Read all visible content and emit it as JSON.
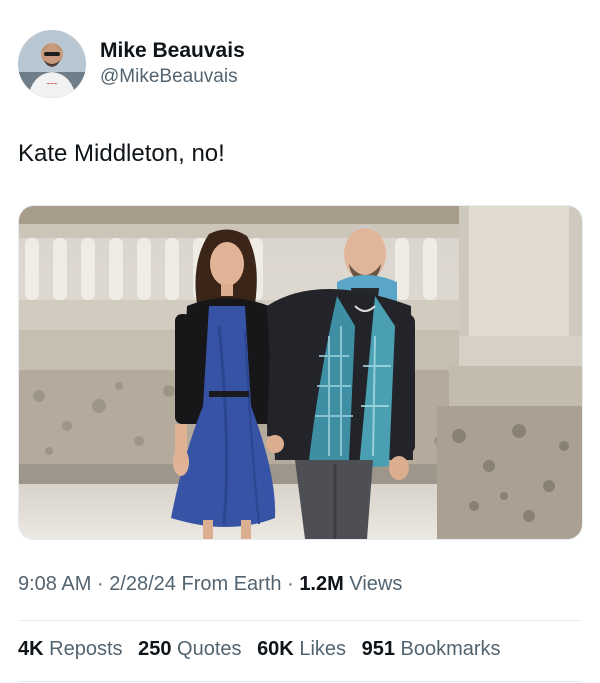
{
  "author": {
    "display_name": "Mike Beauvais",
    "handle": "@MikeBeauvais",
    "avatar_icon": "profile-photo"
  },
  "tweet": {
    "text": "Kate Middleton, no!"
  },
  "meta": {
    "time": "9:08 AM",
    "date": "2/28/24",
    "source": "From Earth",
    "views_count": "1.2M",
    "views_label": "Views",
    "separator": "·"
  },
  "stats": {
    "reposts_count": "4K",
    "reposts_label": "Reposts",
    "quotes_count": "250",
    "quotes_label": "Quotes",
    "likes_count": "60K",
    "likes_label": "Likes",
    "bookmarks_count": "951",
    "bookmarks_label": "Bookmarks"
  }
}
